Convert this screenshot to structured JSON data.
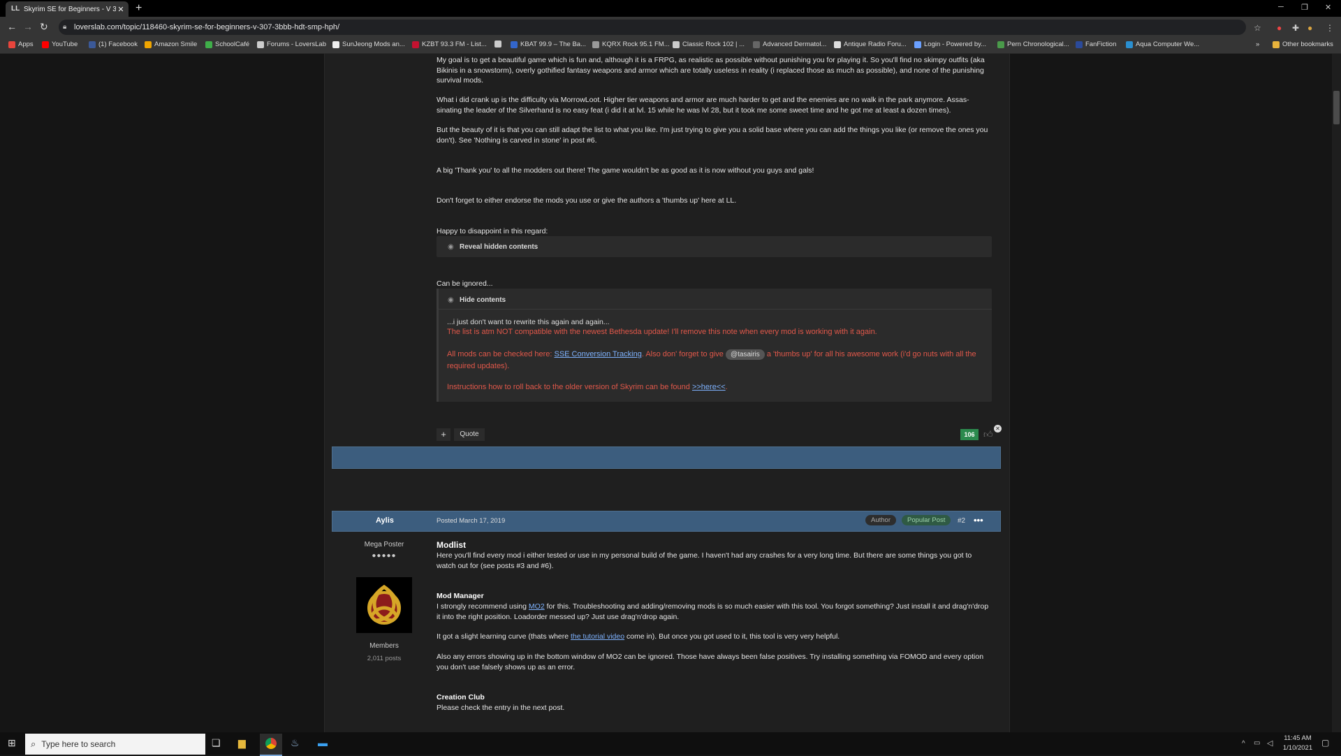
{
  "browser": {
    "tab_title": "Skyrim SE for Beginners - V 3.0.7",
    "tab_close": "✕",
    "new_tab": "+",
    "url": "loverslab.com/topic/118460-skyrim-se-for-beginners-v-307-3bbb-hdt-smp-hph/",
    "bookmarks": [
      {
        "label": "Apps",
        "color": "#e8453c"
      },
      {
        "label": "YouTube",
        "color": "#ff0000"
      },
      {
        "label": "(1) Facebook",
        "color": "#3b5998"
      },
      {
        "label": "Amazon Smile",
        "color": "#f0a500"
      },
      {
        "label": "SchoolCafé",
        "color": "#3fae49"
      },
      {
        "label": "Forums - LoversLab",
        "color": "#cccccc"
      },
      {
        "label": "SunJeong Mods an...",
        "color": "#eeeeee"
      },
      {
        "label": "KZBT 93.3 FM - List...",
        "color": "#c41230"
      },
      {
        "label": "",
        "color": "#cccccc"
      },
      {
        "label": "KBAT 99.9 – The Ba...",
        "color": "#3366cc"
      },
      {
        "label": "KQRX Rock 95.1 FM...",
        "color": "#999999"
      },
      {
        "label": "Classic Rock 102 | ...",
        "color": "#cccccc"
      },
      {
        "label": "Advanced Dermatol...",
        "color": "#666666"
      },
      {
        "label": "Antique Radio Foru...",
        "color": "#dddddd"
      },
      {
        "label": "Login - Powered by...",
        "color": "#6aa0ff"
      },
      {
        "label": "Pern Chronological...",
        "color": "#4a9a4a"
      },
      {
        "label": "FanFiction",
        "color": "#2b4a9a"
      },
      {
        "label": "Aqua Computer We...",
        "color": "#2a8fd0"
      }
    ],
    "more_bookmarks": "»",
    "other_bookmarks": "Other bookmarks"
  },
  "post1": {
    "para1": "My goal is to get a beautiful game which is fun and, although it is a FRPG, as realistic as possible without punishing you for playing it. So you'll find no skimpy outfits (aka Bikinis in a snowstorm), overly gothified fantasy weapons and armor which are totally useless in reality (i replaced those as much as possible), and none of the punishing survival mods.",
    "para2": "What i did crank up is the difficulty via MorrowLoot. Higher tier weapons and armor are much harder to get and the enemies are no walk in the park anymore. Assas-sinating the leader of the Silverhand is no easy feat (i did it at lvl. 15 while he was lvl 28, but it took me some sweet time and he got me at least a dozen times).",
    "para3": "But the beauty of it is that you can still adapt the list to what you like. I'm just trying to give you a solid base where you can add the things you like (or remove the ones you don't). See 'Nothing is carved in stone' in post #6.",
    "para4": "A big 'Thank you' to all the modders out there! The game wouldn't be as good as it is now without you guys and gals!",
    "para5": "Don't forget to either endorse the mods you use or give the authors a 'thumbs up' here at LL.",
    "para6": "Happy to disappoint in this regard:",
    "reveal": "Reveal hidden contents",
    "para7": "Can be ignored...",
    "hide": "Hide contents",
    "hidden_intro": "...i just don't want to rewrite this again and again...",
    "hidden_red1": "The list is atm NOT compatible with the newest Bethesda update! I'll remove this note when every mod is working with it again.",
    "hidden_red2a": "All mods can be checked here: ",
    "hidden_link1": "SSE Conversion Tracking",
    "hidden_red2b": ". Also don' forget to give ",
    "mention": "@tasairis",
    "hidden_red2c": " a 'thumbs up' for all his awesome work (i'd go nuts with all the required updates).",
    "hidden_red3a": "Instructions how to roll back to the older version of Skyrim can be found ",
    "hidden_link2": ">>here<<",
    "hidden_red3b": ".",
    "plus": "+",
    "quote": "Quote",
    "reactions": "106"
  },
  "post2": {
    "author": "Aylis",
    "posted": "Posted March 17, 2019",
    "badge_author": "Author",
    "badge_popular": "Popular Post",
    "post_num": "#2",
    "more": "•••",
    "rank": "Mega Poster",
    "pips": "●●●●●",
    "group": "Members",
    "posts": "2,011 posts",
    "title": "Modlist",
    "intro": "Here you'll find every mod i either tested or use in my personal build of the game. I haven't had any crashes for a very long time. But there are some things you got to watch out for (see posts #3 and #6).",
    "h_mm": "Mod Manager",
    "mm1a": "I strongly recommend using ",
    "mm1_link": "MO2",
    "mm1b": " for this. Troubleshooting and adding/removing mods is so much easier with this tool. You forgot something? Just install it and drag'n'drop it into the right position. Loadorder messed up? Just use drag'n'drop again.",
    "mm2a": "It got a slight learning curve (thats where ",
    "mm2_link": "the tutorial video",
    "mm2b": " come in). But once you got used to it, this tool is very very helpful.",
    "mm3": "Also any errors showing up in the bottom window of MO2 can be ignored. Those have always been false positives. Try installing something via FOMOD and every option you don't use falsely shows up as an error.",
    "h_cc": "Creation Club",
    "cc1": "Please check the entry in the next post."
  },
  "taskbar": {
    "search_placeholder": "Type here to search",
    "time": "11:45 AM",
    "date": "1/10/2021"
  }
}
